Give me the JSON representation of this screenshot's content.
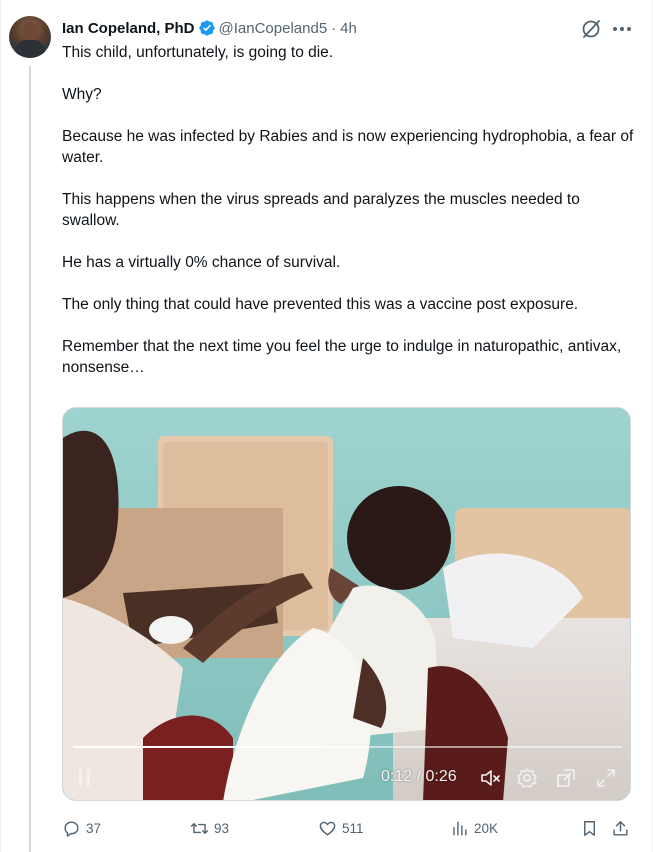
{
  "author": {
    "display_name": "Ian Copeland, PhD",
    "handle": "@IanCopeland5",
    "separator": "·",
    "time": "4h",
    "verified": true,
    "verified_color": "#1d9bf0"
  },
  "tweet": {
    "paragraphs": [
      "This child, unfortunately, is going to die.",
      "Why?",
      "Because he was infected by Rabies and is now experiencing hydrophobia, a fear of water.",
      "This happens when the virus spreads and paralyzes the muscles needed to swallow.",
      "He has a virtually 0% chance of survival.",
      "The only thing that could have prevented this was a vaccine post exposure.",
      "Remember that the next time you feel the urge to indulge in naturopathic, antivax, nonsense…"
    ]
  },
  "video": {
    "elapsed_inline": "0:13",
    "time_readout": "0:12 / 0:26",
    "progress_fraction": 0.46,
    "icons": [
      "pause-icon",
      "mute-icon",
      "settings-icon",
      "fullscreen-exit-icon",
      "expand-icon"
    ]
  },
  "actions": {
    "replies": "37",
    "reposts": "93",
    "likes": "511",
    "views": "20K"
  },
  "colors": {
    "text": "#0f1419",
    "secondary": "#536471",
    "accent": "#1d9bf0",
    "thread_line": "#cfd9de"
  }
}
